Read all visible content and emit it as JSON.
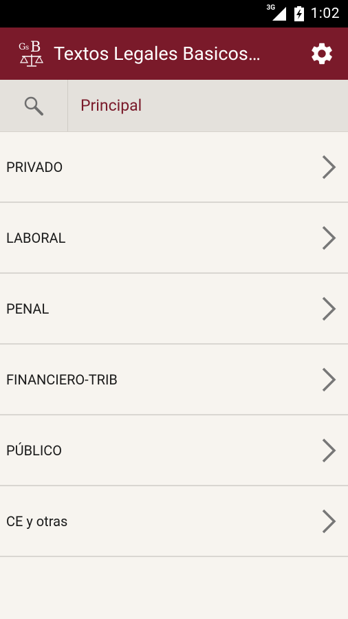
{
  "status_bar": {
    "network_label": "3G",
    "time": "1:02"
  },
  "app_bar": {
    "title": "Textos Legales Basicos…",
    "logo_text": "GsB"
  },
  "search_bar": {
    "breadcrumb": "Principal"
  },
  "categories": [
    {
      "label": "PRIVADO"
    },
    {
      "label": "LABORAL"
    },
    {
      "label": "PENAL"
    },
    {
      "label": "FINANCIERO-TRIB"
    },
    {
      "label": "PÚBLICO"
    },
    {
      "label": "CE y otras"
    }
  ],
  "colors": {
    "primary": "#7a1a2a",
    "background": "#f7f4ef",
    "search_bar": "#e4e1dc"
  }
}
